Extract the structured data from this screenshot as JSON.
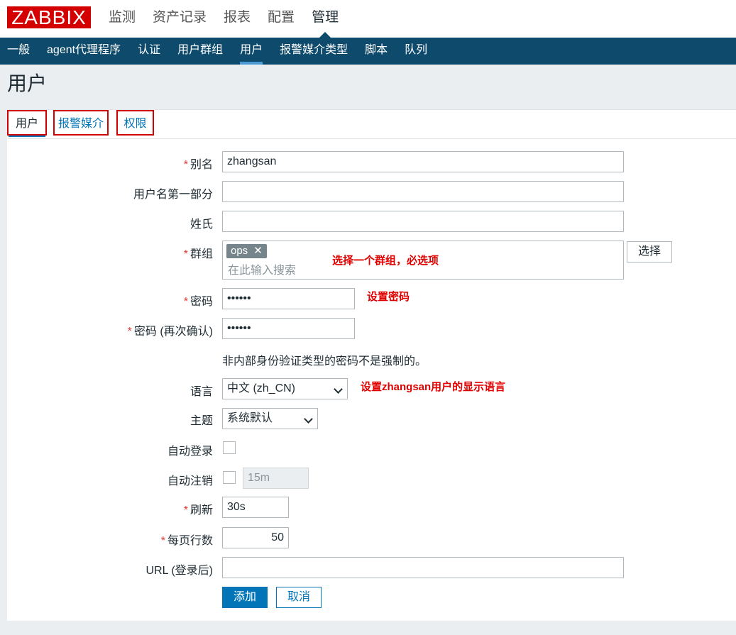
{
  "logo": "ZABBIX",
  "main_nav": [
    "监测",
    "资产记录",
    "报表",
    "配置",
    "管理"
  ],
  "main_nav_active": "管理",
  "sub_nav": [
    "一般",
    "agent代理程序",
    "认证",
    "用户群组",
    "用户",
    "报警媒介类型",
    "脚本",
    "队列"
  ],
  "sub_nav_active": "用户",
  "page_title": "用户",
  "tabs": {
    "user": "用户",
    "media": "报警媒介",
    "permissions": "权限"
  },
  "form": {
    "alias": {
      "label": "别名",
      "value": "zhangsan"
    },
    "name": {
      "label": "用户名第一部分",
      "value": ""
    },
    "surname": {
      "label": "姓氏",
      "value": ""
    },
    "groups": {
      "label": "群组",
      "chip": "ops",
      "placeholder": "在此输入搜索",
      "select_button": "选择"
    },
    "password": {
      "label": "密码",
      "value": "••••••"
    },
    "password_confirm": {
      "label": "密码 (再次确认)",
      "value": "••••••"
    },
    "password_hint": "非内部身份验证类型的密码不是强制的。",
    "language": {
      "label": "语言",
      "value": "中文 (zh_CN)"
    },
    "theme": {
      "label": "主题",
      "value": "系统默认"
    },
    "autologin": {
      "label": "自动登录"
    },
    "autologout": {
      "label": "自动注销",
      "value": "15m"
    },
    "refresh": {
      "label": "刷新",
      "value": "30s"
    },
    "rows_per_page": {
      "label": "每页行数",
      "value": "50"
    },
    "url": {
      "label": "URL (登录后)",
      "value": ""
    },
    "add_button": "添加",
    "cancel_button": "取消",
    "required_mark": "*"
  },
  "annotations": {
    "groups": "选择一个群组，必选项",
    "password": "设置密码",
    "language": "设置zhangsan用户的显示语言"
  },
  "colors": {
    "logo_red": "#d40000",
    "subnav_blue": "#0e4a6b",
    "primary_blue": "#0275b8",
    "annotation_red": "#e00000"
  }
}
